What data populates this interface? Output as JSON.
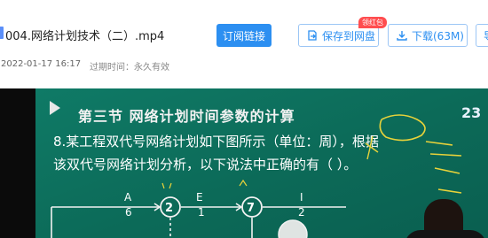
{
  "file": {
    "title": "004.网络计划技术（二）.mp4",
    "date": "2022-01-17 16:17",
    "expire": "过期时间：永久有效"
  },
  "buttons": {
    "subscribe": "订阅链接",
    "save": "保存到网盘",
    "save_badge": "领红包",
    "download": "下载(63M)",
    "extra": "导"
  },
  "icons": {
    "save": "save-to-cloud-icon",
    "download": "download-icon"
  },
  "colors": {
    "primary": "#2c8ff1",
    "badge": "#ff4d4f",
    "board": "#0c6a58"
  },
  "video": {
    "section_title": "第三节  网络计划时间参数的计算",
    "question_line1": "8.某工程双代号网络计划如下图所示（单位：周），根据",
    "question_line2": "该双代号网络计划分析，以下说法中正确的有（      ）。",
    "corner_number": "23",
    "network": {
      "activities": [
        {
          "name": "A",
          "duration": "6"
        },
        {
          "name": "E",
          "duration": "1"
        },
        {
          "name": "I",
          "duration": "2"
        }
      ],
      "nodes": [
        "2",
        "7"
      ]
    }
  }
}
